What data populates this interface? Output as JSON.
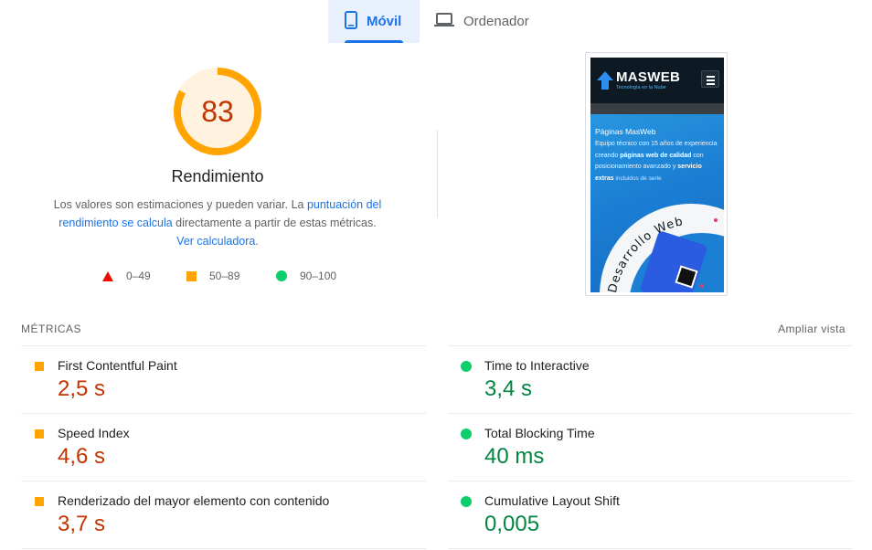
{
  "tabs": [
    {
      "label": "Móvil",
      "active": true,
      "icon": "smartphone-icon"
    },
    {
      "label": "Ordenador",
      "active": false,
      "icon": "laptop-icon"
    }
  ],
  "gauge": {
    "score": "83",
    "score_fraction": 0.83,
    "title": "Rendimiento",
    "desc_part1": "Los valores son estimaciones y pueden variar. La ",
    "desc_link1": "puntuación del rendimiento se calcula",
    "desc_part2": " directamente a partir de estas métricas. ",
    "desc_link2": "Ver calculadora",
    "desc_part3": ".",
    "color": "#ffa400"
  },
  "legend": [
    {
      "range": "0–49",
      "shape": "triangle",
      "color": "#eb0f00"
    },
    {
      "range": "50–89",
      "shape": "square",
      "color": "#ffa400"
    },
    {
      "range": "90–100",
      "shape": "circle",
      "color": "#0cce6b"
    }
  ],
  "screenshot": {
    "brand": "MASWEB",
    "tagline": "Tecnología en la Nube",
    "heading": "Páginas MasWeb",
    "text_a": "Equipo técnico con 15 años de experiencia creando ",
    "text_b": "páginas web de calidad",
    "text_c": " con posicionamiento avanzado y ",
    "text_d": "servicio extras",
    "text_e": " incluidos de serie",
    "curved_text": "Desarrollo Web"
  },
  "metrics": {
    "title": "Métricas",
    "toggle_label": "Ampliar vista",
    "left": [
      {
        "name": "First Contentful Paint",
        "value": "2,5 s",
        "status": "average"
      },
      {
        "name": "Speed Index",
        "value": "4,6 s",
        "status": "average"
      },
      {
        "name": "Renderizado del mayor elemento con contenido",
        "value": "3,7 s",
        "status": "average"
      }
    ],
    "right": [
      {
        "name": "Time to Interactive",
        "value": "3,4 s",
        "status": "pass"
      },
      {
        "name": "Total Blocking Time",
        "value": "40 ms",
        "status": "pass"
      },
      {
        "name": "Cumulative Layout Shift",
        "value": "0,005",
        "status": "pass"
      }
    ]
  },
  "colors": {
    "accent": "#1a73e8",
    "average": "#ffa400",
    "average_text": "#c33300",
    "pass": "#0cce6b",
    "pass_text": "#018642",
    "fail": "#eb0f00"
  }
}
